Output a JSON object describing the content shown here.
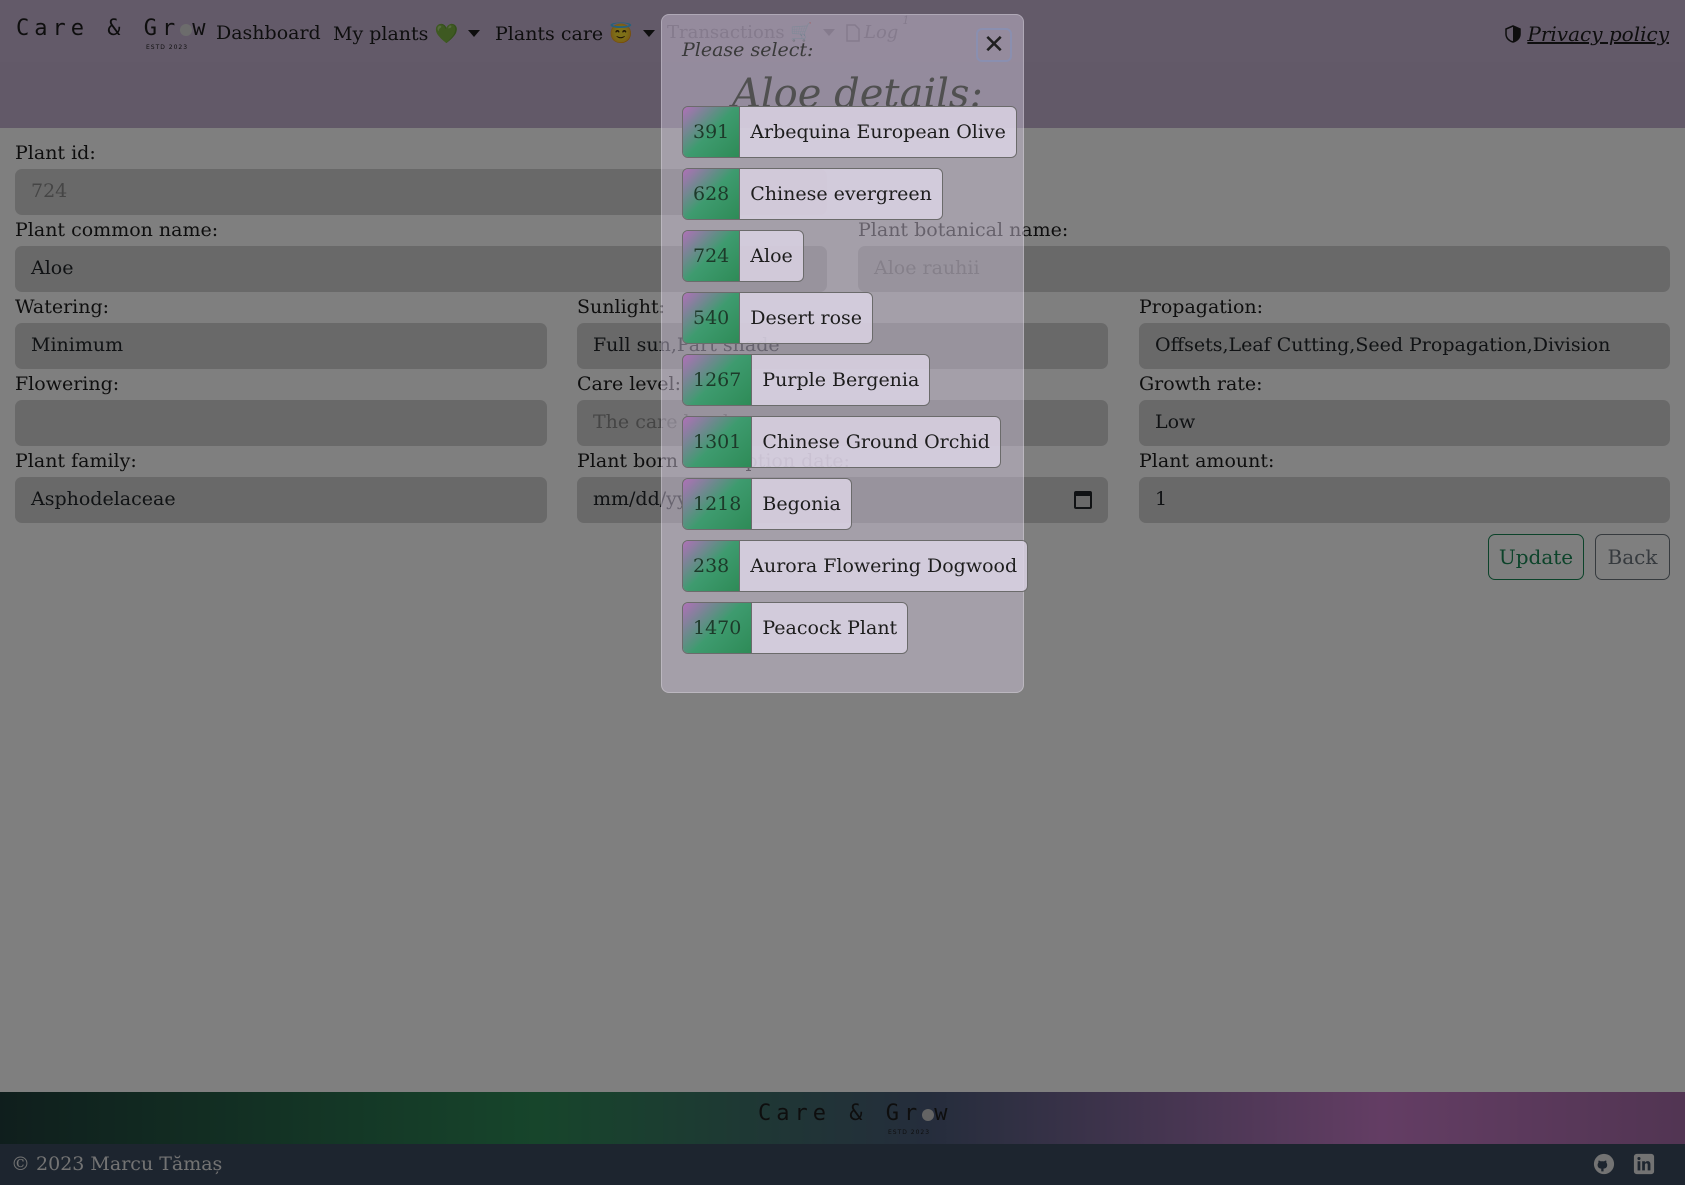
{
  "nav": {
    "brand": "Care & Gr",
    "brand_end": "w",
    "brand_estd": "ESTD 2023",
    "dashboard": "Dashboard",
    "my_plants": "My plants 💚",
    "plants_care": "Plants care 😇",
    "transactions": "Transactions 🛒",
    "log": "Log",
    "log_badge": "1",
    "privacy": "Privacy policy"
  },
  "form": {
    "plant_id_label": "Plant id:",
    "plant_id_value": "724",
    "common_name_label": "Plant common name:",
    "common_name_value": "Aloe",
    "botanical_name_label": "Plant botanical name:",
    "botanical_name_value": "Aloe rauhii",
    "watering_label": "Watering:",
    "watering_value": "Minimum",
    "sunlight_label": "Sunlight:",
    "sunlight_value": "Full sun,Part shade",
    "propagation_label": "Propagation:",
    "propagation_value": "Offsets,Leaf Cutting,Seed Propagation,Division",
    "flowering_label": "Flowering:",
    "flowering_value": "",
    "care_level_label": "Care level:",
    "care_level_placeholder": "The care level",
    "growth_rate_label": "Growth rate:",
    "growth_rate_value": "Low",
    "family_label": "Plant family:",
    "family_value": "Asphodelaceae",
    "born_label": "Plant born or adoption date:",
    "born_placeholder": "mm/dd/yyyy",
    "amount_label": "Plant amount:",
    "amount_value": "1",
    "update_button": "Update",
    "back_button": "Back"
  },
  "modal": {
    "title": "Please select:",
    "heading": "Aloe details:",
    "close_label": "✕",
    "plants": [
      {
        "id": "391",
        "name": "Arbequina European Olive"
      },
      {
        "id": "628",
        "name": "Chinese evergreen"
      },
      {
        "id": "724",
        "name": "Aloe"
      },
      {
        "id": "540",
        "name": "Desert rose"
      },
      {
        "id": "1267",
        "name": "Purple Bergenia"
      },
      {
        "id": "1301",
        "name": "Chinese Ground Orchid"
      },
      {
        "id": "1218",
        "name": "Begonia"
      },
      {
        "id": "238",
        "name": "Aurora Flowering Dogwood"
      },
      {
        "id": "1470",
        "name": "Peacock Plant"
      }
    ]
  },
  "footer": {
    "brand": "Care & Gr",
    "brand_end": "w",
    "brand_estd": "ESTD 2023",
    "copyright": "© 2023 Marcu Tămaș"
  },
  "icons": {
    "heart": "green-heart-icon",
    "angel": "angel-face-icon",
    "cart": "cart-icon",
    "log": "file-icon",
    "privacy": "shield-icon",
    "calendar": "calendar-icon",
    "github": "github-icon",
    "linkedin": "linkedin-icon"
  },
  "colors": {
    "navbar": "#c7b4d3",
    "field_bg": "#d3d3d3",
    "update_green": "#198754",
    "back_gray": "#6c757d",
    "footer_bottom": "#3a4b5e"
  }
}
